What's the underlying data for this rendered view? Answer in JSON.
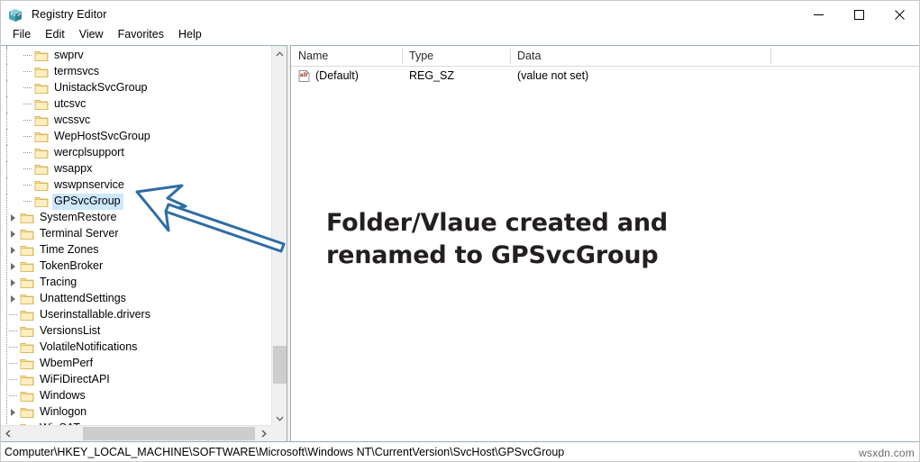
{
  "window": {
    "title": "Registry Editor",
    "icon": "registry-editor-icon",
    "controls": {
      "minimize": "minimize-icon",
      "maximize": "maximize-icon",
      "close": "close-icon"
    }
  },
  "menu": {
    "items": [
      {
        "label": "File"
      },
      {
        "label": "Edit"
      },
      {
        "label": "View"
      },
      {
        "label": "Favorites"
      },
      {
        "label": "Help"
      }
    ]
  },
  "tree": {
    "items": [
      {
        "label": "swprv",
        "depth": 2,
        "expandable": false,
        "selected": false
      },
      {
        "label": "termsvcs",
        "depth": 2,
        "expandable": false,
        "selected": false
      },
      {
        "label": "UnistackSvcGroup",
        "depth": 2,
        "expandable": false,
        "selected": false
      },
      {
        "label": "utcsvc",
        "depth": 2,
        "expandable": false,
        "selected": false
      },
      {
        "label": "wcssvc",
        "depth": 2,
        "expandable": false,
        "selected": false
      },
      {
        "label": "WepHostSvcGroup",
        "depth": 2,
        "expandable": false,
        "selected": false
      },
      {
        "label": "wercplsupport",
        "depth": 2,
        "expandable": false,
        "selected": false
      },
      {
        "label": "wsappx",
        "depth": 2,
        "expandable": false,
        "selected": false
      },
      {
        "label": "wswpnservice",
        "depth": 2,
        "expandable": false,
        "selected": false
      },
      {
        "label": "GPSvcGroup",
        "depth": 2,
        "expandable": false,
        "selected": true
      },
      {
        "label": "SystemRestore",
        "depth": 1,
        "expandable": true,
        "selected": false
      },
      {
        "label": "Terminal Server",
        "depth": 1,
        "expandable": true,
        "selected": false
      },
      {
        "label": "Time Zones",
        "depth": 1,
        "expandable": true,
        "selected": false
      },
      {
        "label": "TokenBroker",
        "depth": 1,
        "expandable": true,
        "selected": false
      },
      {
        "label": "Tracing",
        "depth": 1,
        "expandable": true,
        "selected": false
      },
      {
        "label": "UnattendSettings",
        "depth": 1,
        "expandable": true,
        "selected": false
      },
      {
        "label": "Userinstallable.drivers",
        "depth": 1,
        "expandable": false,
        "selected": false
      },
      {
        "label": "VersionsList",
        "depth": 1,
        "expandable": false,
        "selected": false
      },
      {
        "label": "VolatileNotifications",
        "depth": 1,
        "expandable": false,
        "selected": false
      },
      {
        "label": "WbemPerf",
        "depth": 1,
        "expandable": false,
        "selected": false
      },
      {
        "label": "WiFiDirectAPI",
        "depth": 1,
        "expandable": false,
        "selected": false
      },
      {
        "label": "Windows",
        "depth": 1,
        "expandable": false,
        "selected": false
      },
      {
        "label": "Winlogon",
        "depth": 1,
        "expandable": true,
        "selected": false
      },
      {
        "label": "WinSAT",
        "depth": 1,
        "expandable": false,
        "selected": false
      }
    ]
  },
  "values_list": {
    "columns": [
      {
        "label": "Name"
      },
      {
        "label": "Type"
      },
      {
        "label": "Data"
      }
    ],
    "rows": [
      {
        "icon": "string-value-icon",
        "name": "(Default)",
        "type": "REG_SZ",
        "data": "(value not set)"
      }
    ]
  },
  "annotation": {
    "line1": "Folder/Vlaue created and",
    "line2": "renamed to GPSvcGroup",
    "arrow_color": "#2e6da4",
    "text_color": "#231f20"
  },
  "statusbar": {
    "path": "Computer\\HKEY_LOCAL_MACHINE\\SOFTWARE\\Microsoft\\Windows NT\\CurrentVersion\\SvcHost\\GPSvcGroup"
  },
  "watermark": {
    "text": "wsxdn.com"
  },
  "scrollbars": {
    "vertical": {
      "up": "scroll-up-arrow",
      "down": "scroll-down-arrow"
    },
    "horizontal": {
      "left": "scroll-left-arrow",
      "right": "scroll-right-arrow"
    }
  }
}
